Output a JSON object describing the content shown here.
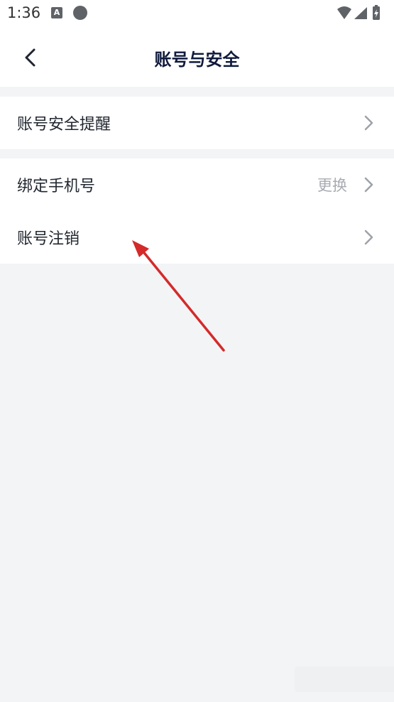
{
  "status_bar": {
    "time": "1:36",
    "icons": [
      "a-app-icon",
      "dot-icon",
      "wifi-icon",
      "signal-icon",
      "battery-icon"
    ]
  },
  "header": {
    "title": "账号与安全",
    "back_icon": "chevron-left-icon"
  },
  "groups": [
    {
      "rows": [
        {
          "label": "账号安全提醒",
          "value": ""
        }
      ]
    },
    {
      "rows": [
        {
          "label": "绑定手机号",
          "value": "更换"
        },
        {
          "label": "账号注销",
          "value": ""
        }
      ]
    }
  ],
  "colors": {
    "background": "#f3f4f6",
    "title": "#0f1a3c",
    "annotation_arrow": "#d42a2a"
  }
}
